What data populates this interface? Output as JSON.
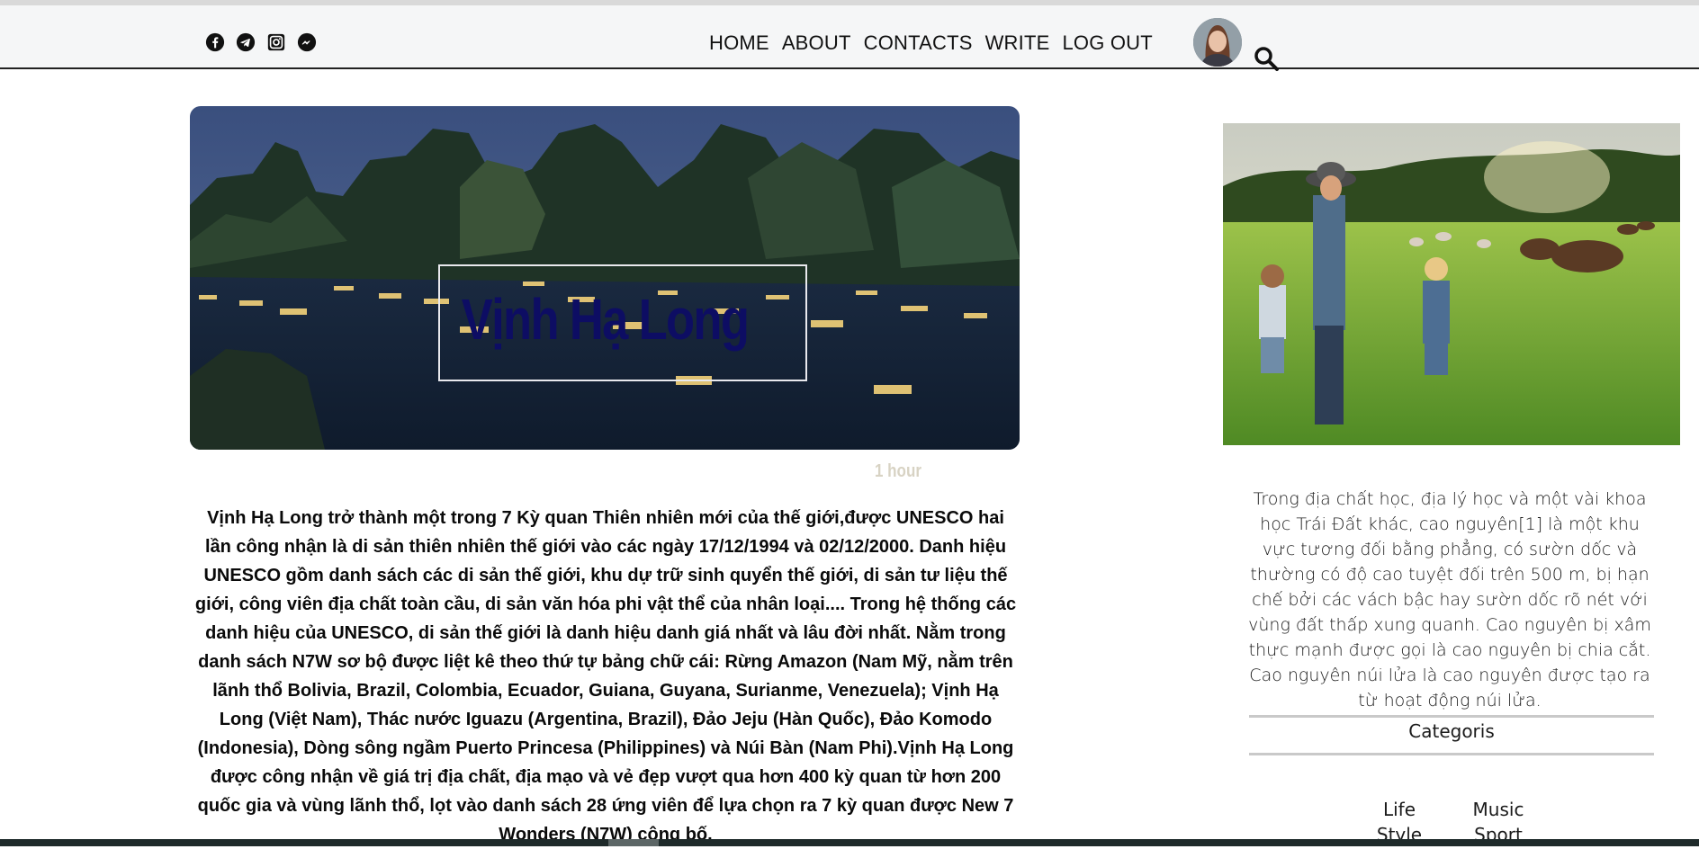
{
  "header": {
    "socials": [
      {
        "icon": "facebook-icon"
      },
      {
        "icon": "telegram-icon"
      },
      {
        "icon": "instagram-icon"
      },
      {
        "icon": "messenger-icon"
      }
    ],
    "nav": [
      "HOME",
      "ABOUT",
      "CONTACTS",
      "WRITE",
      "LOG OUT"
    ],
    "avatar_icon": "user-avatar",
    "search_icon": "search-icon"
  },
  "hero": {
    "title": "Vịnh Hạ Long",
    "title_color": "#0d0d63"
  },
  "post": {
    "time": "1 hour",
    "body": "Vịnh Hạ Long trở thành một trong 7 Kỳ quan Thiên nhiên mới của thế giới,được UNESCO hai lần công nhận là di sản thiên nhiên thế giới vào các ngày 17/12/1994 và 02/12/2000. Danh hiệu UNESCO gồm danh sách các di sản thế giới, khu dự trữ sinh quyển thế giới, di sản tư liệu thế giới, công viên địa chất toàn cầu, di sản văn hóa phi vật thể của nhân loại.... Trong hệ thống các danh hiệu của UNESCO, di sản thế giới là danh hiệu danh giá nhất và lâu đời nhất. Nằm trong danh sách N7W sơ bộ được liệt kê theo thứ tự bảng chữ cái: Rừng Amazon (Nam Mỹ, nằm trên lãnh thổ Bolivia, Brazil, Colombia, Ecuador, Guiana, Guyana, Surianme, Venezuela); Vịnh Hạ Long (Việt Nam), Thác nước Iguazu (Argentina, Brazil), Đảo Jeju (Hàn Quốc), Đảo Komodo (Indonesia), Dòng sông ngầm Puerto Princesa (Philippines) và Núi Bàn (Nam Phi).Vịnh Hạ Long được công nhận về giá trị địa chất, địa mạo và vẻ đẹp vượt qua hơn 400 kỳ quan từ hơn 200 quốc gia và vùng lãnh thổ, lọt vào danh sách 28 ứng viên để lựa chọn ra 7 kỳ quan được New 7 Wonders (N7W) công bố."
  },
  "sidebar": {
    "text": "Trong địa chất học, địa lý học và một vài khoa học Trái Đất khác, cao nguyên[1] là một khu vực tương đối bằng phẳng, có sườn dốc và thường có độ cao tuyệt đối trên 500 m, bị hạn chế bởi các vách bậc hay sườn dốc rõ nét với vùng đất thấp xung quanh. Cao nguyên bị xâm thực mạnh được gọi là cao nguyên bị chia cắt. Cao nguyên núi lửa là cao nguyên được tạo ra từ hoạt động núi lửa.",
    "categories_title": "Categoris",
    "categories_col1": [
      "Life",
      "Style"
    ],
    "categories_col2": [
      "Music",
      "Sport"
    ]
  }
}
